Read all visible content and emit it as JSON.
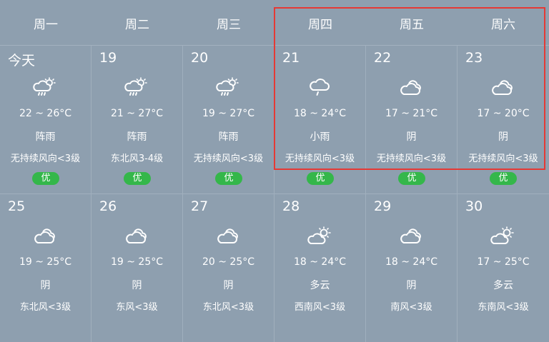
{
  "weekdays": [
    "周一",
    "周二",
    "周三",
    "周四",
    "周五",
    "周六"
  ],
  "days": [
    {
      "day": "今天",
      "icon": "rain-sun-icon",
      "temp": "22 ~ 26°C",
      "desc": "阵雨",
      "wind": "无持续风向<3级",
      "aqi": "优"
    },
    {
      "day": "19",
      "icon": "rain-sun-icon",
      "temp": "21 ~ 27°C",
      "desc": "阵雨",
      "wind": "东北风3-4级",
      "aqi": "优"
    },
    {
      "day": "20",
      "icon": "rain-sun-icon",
      "temp": "19 ~ 27°C",
      "desc": "阵雨",
      "wind": "无持续风向<3级",
      "aqi": "优"
    },
    {
      "day": "21",
      "icon": "light-rain-icon",
      "temp": "18 ~ 24°C",
      "desc": "小雨",
      "wind": "无持续风向<3级",
      "aqi": "优"
    },
    {
      "day": "22",
      "icon": "overcast-icon",
      "temp": "17 ~ 21°C",
      "desc": "阴",
      "wind": "无持续风向<3级",
      "aqi": "优"
    },
    {
      "day": "23",
      "icon": "overcast-icon",
      "temp": "17 ~ 20°C",
      "desc": "阴",
      "wind": "无持续风向<3级",
      "aqi": "优"
    },
    {
      "day": "25",
      "icon": "overcast-icon",
      "temp": "19 ~ 25°C",
      "desc": "阴",
      "wind": "东北风<3级"
    },
    {
      "day": "26",
      "icon": "overcast-icon",
      "temp": "19 ~ 25°C",
      "desc": "阴",
      "wind": "东风<3级"
    },
    {
      "day": "27",
      "icon": "overcast-icon",
      "temp": "20 ~ 25°C",
      "desc": "阴",
      "wind": "东北风<3级"
    },
    {
      "day": "28",
      "icon": "partly-cloudy-icon",
      "temp": "18 ~ 24°C",
      "desc": "多云",
      "wind": "西南风<3级"
    },
    {
      "day": "29",
      "icon": "overcast-icon",
      "temp": "18 ~ 24°C",
      "desc": "阴",
      "wind": "南风<3级"
    },
    {
      "day": "30",
      "icon": "partly-cloudy-icon",
      "temp": "17 ~ 25°C",
      "desc": "多云",
      "wind": "东南风<3级"
    }
  ],
  "colors": {
    "background": "#8e9faf",
    "aqi_good": "#34b74a",
    "highlight": "#e53935"
  }
}
